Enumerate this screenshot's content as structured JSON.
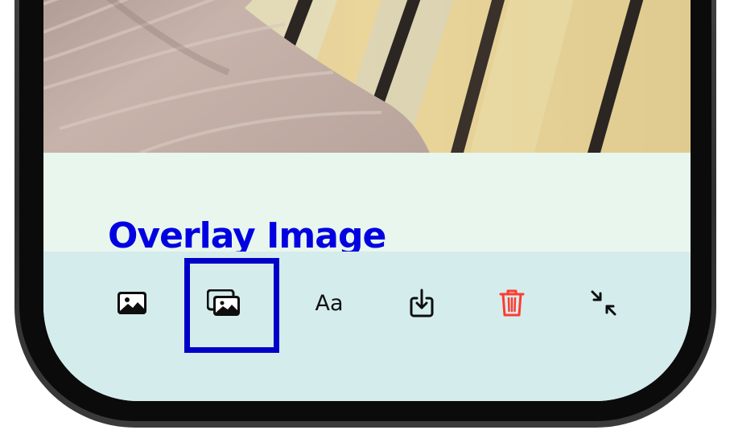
{
  "caption": {
    "text": "Overlay Image",
    "color": "#0000e0"
  },
  "toolbar": {
    "items": [
      {
        "name": "image",
        "icon": "photo-icon"
      },
      {
        "name": "overlay-image",
        "icon": "photo-stack-icon",
        "highlighted": true
      },
      {
        "name": "text",
        "icon": "text-format-icon",
        "label": "Aa"
      },
      {
        "name": "save",
        "icon": "download-icon"
      },
      {
        "name": "delete",
        "icon": "trash-icon",
        "color": "#ff3b30"
      },
      {
        "name": "collapse",
        "icon": "collapse-arrows-icon"
      }
    ],
    "highlight_color": "#0000c8",
    "background": "#d5ecec"
  },
  "colors": {
    "caption_band": "#e8f6ee",
    "phone_frame": "#0b0b0b"
  }
}
